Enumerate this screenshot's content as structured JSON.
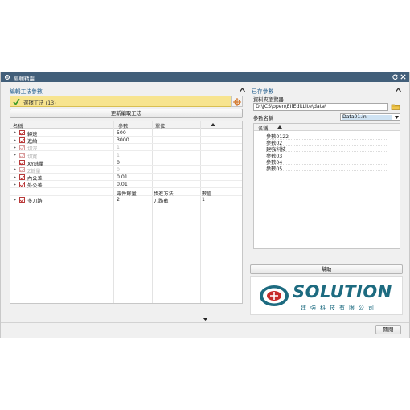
{
  "window": {
    "title": "編輯精靈"
  },
  "left": {
    "section_title": "編輯工法參數",
    "operations_label": "選擇工法 (13)",
    "update_button": "更新編取工法",
    "columns": [
      "名稱",
      "參數",
      "單位"
    ],
    "rows": [
      {
        "name": "轉速",
        "value": "500",
        "unit": "",
        "checked": true,
        "dim": false
      },
      {
        "name": "進給",
        "value": "3000",
        "unit": "",
        "checked": true,
        "dim": false
      },
      {
        "name": "切深",
        "value": "1",
        "unit": "",
        "checked": true,
        "dim": true
      },
      {
        "name": "切寬",
        "value": "1",
        "unit": "",
        "checked": true,
        "dim": true
      },
      {
        "name": "XY餘量",
        "value": "0",
        "unit": "",
        "checked": true,
        "dim": false
      },
      {
        "name": "Z餘量",
        "value": "0",
        "unit": "",
        "checked": true,
        "dim": true
      },
      {
        "name": "內公差",
        "value": "0.01",
        "unit": "",
        "checked": true,
        "dim": false
      },
      {
        "name": "外公差",
        "value": "0.01",
        "unit": "",
        "checked": true,
        "dim": false
      }
    ],
    "subheader": {
      "a": "零件餘量",
      "b": "步進方法",
      "c": "數值"
    },
    "multi_row": {
      "name": "多刀路",
      "a": "2",
      "b": "刀路數",
      "c": "1"
    }
  },
  "right": {
    "section_title": "已存參數",
    "path_label": "資料夾瀏覽器",
    "path_value": "D:\\JCS\\open\\EIfEditLite\\data\\",
    "name_label": "參數名稱",
    "name_value": "Data01.ini",
    "list_header": "名稱",
    "list_items": [
      "參數0122",
      "參數02",
      "建強科技",
      "參數03",
      "參數04",
      "參數05"
    ],
    "help_button": "幫助",
    "logo_text": "SOLUTION",
    "logo_sub": "建強科技有限公司"
  },
  "footer": {
    "close_button": "關閉"
  },
  "colors": {
    "titlebar": "#425f7a",
    "section_title": "#1e5b8c",
    "highlight": "#f7e48f",
    "logo": "#1d6b80",
    "selection": "#cfe3f3"
  },
  "icons": [
    "gear-icon",
    "reset-icon",
    "close-icon",
    "collapse-icon",
    "check-icon",
    "crosshair-icon",
    "folder-icon",
    "dropdown-arrow-icon",
    "sort-icon",
    "expand-arrow-icon"
  ]
}
